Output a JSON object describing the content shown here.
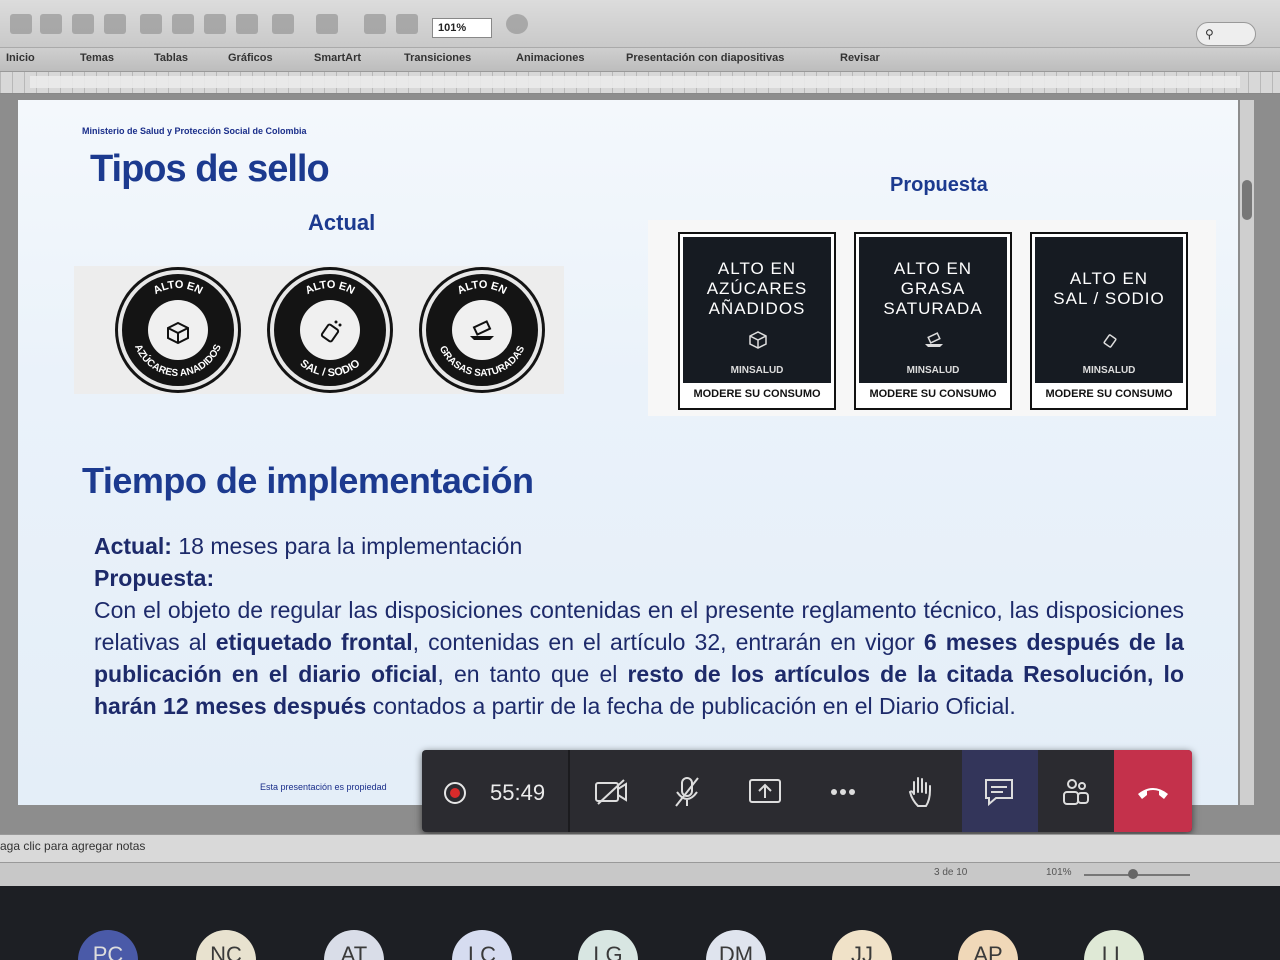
{
  "toolbar": {
    "zoom": "101%",
    "search_icon": "search-icon"
  },
  "ribbon": {
    "tabs": [
      "Inicio",
      "Temas",
      "Tablas",
      "Gráficos",
      "SmartArt",
      "Transiciones",
      "Animaciones",
      "Presentación con diapositivas",
      "Revisar"
    ]
  },
  "slide": {
    "ministry": "Ministerio de Salud y Protección Social de Colombia",
    "title": "Tipos de sello",
    "actual_label": "Actual",
    "propuesta_label": "Propuesta",
    "seals": [
      {
        "top": "ALTO EN",
        "bottom": "AZÚCARES ANADIDOS",
        "icon": "cubes-icon"
      },
      {
        "top": "ALTO EN",
        "bottom": "SAL / SODIO",
        "icon": "salt-shaker-icon"
      },
      {
        "top": "ALTO EN",
        "bottom": "GRASAS SATURADAS",
        "icon": "butter-icon"
      }
    ],
    "octagons": [
      {
        "label": "ALTO EN\nAZÚCARES\nAÑADIDOS",
        "brand": "MINSALUD",
        "footer": "MODERE SU CONSUMO",
        "icon": "cubes-icon"
      },
      {
        "label": "ALTO EN\nGRASA\nSATURADA",
        "brand": "MINSALUD",
        "footer": "MODERE SU CONSUMO",
        "icon": "butter-icon"
      },
      {
        "label": "ALTO EN\nSAL / SODIO",
        "brand": "MINSALUD",
        "footer": "MODERE SU CONSUMO",
        "icon": "salt-shaker-icon"
      }
    ],
    "section_title": "Tiempo de implementación",
    "actual_prefix": "Actual:",
    "actual_text": " 18 meses para la implementación",
    "propuesta_prefix": "Propuesta:",
    "para": {
      "t1": "Con el objeto de regular las disposiciones contenidas en el presente reglamento técnico, las disposiciones relativas al ",
      "b1": "etiquetado frontal",
      "t2": ", contenidas en el artículo 32, entrarán en vigor ",
      "b2": "6 meses después de la publicación en el diario oficial",
      "t3": ", en tanto que el ",
      "b3": "resto de los artículos de la citada Resolución, lo harán 12 meses después",
      "t4": " contados a partir de la fecha de publicación en el Diario Oficial."
    },
    "footnote": "Esta presentación es propiedad"
  },
  "callbar": {
    "time": "55:49",
    "icons": [
      "record-icon",
      "camera-off-icon",
      "mic-off-icon",
      "share-screen-icon",
      "more-icon",
      "raise-hand-icon",
      "chat-icon",
      "participants-icon",
      "hang-up-icon"
    ]
  },
  "notes": {
    "placeholder": "aga clic para agregar notas"
  },
  "status": {
    "slide": "3 de 10",
    "zoom": "101%"
  },
  "participants": [
    "PC",
    "NC",
    "AT",
    "LC",
    "LG",
    "DM",
    "JJ",
    "AP",
    "LL"
  ],
  "colors": {
    "title_blue": "#1c3a8f",
    "end_call_red": "#c4314b",
    "callbar_bg": "#2b2b30"
  }
}
